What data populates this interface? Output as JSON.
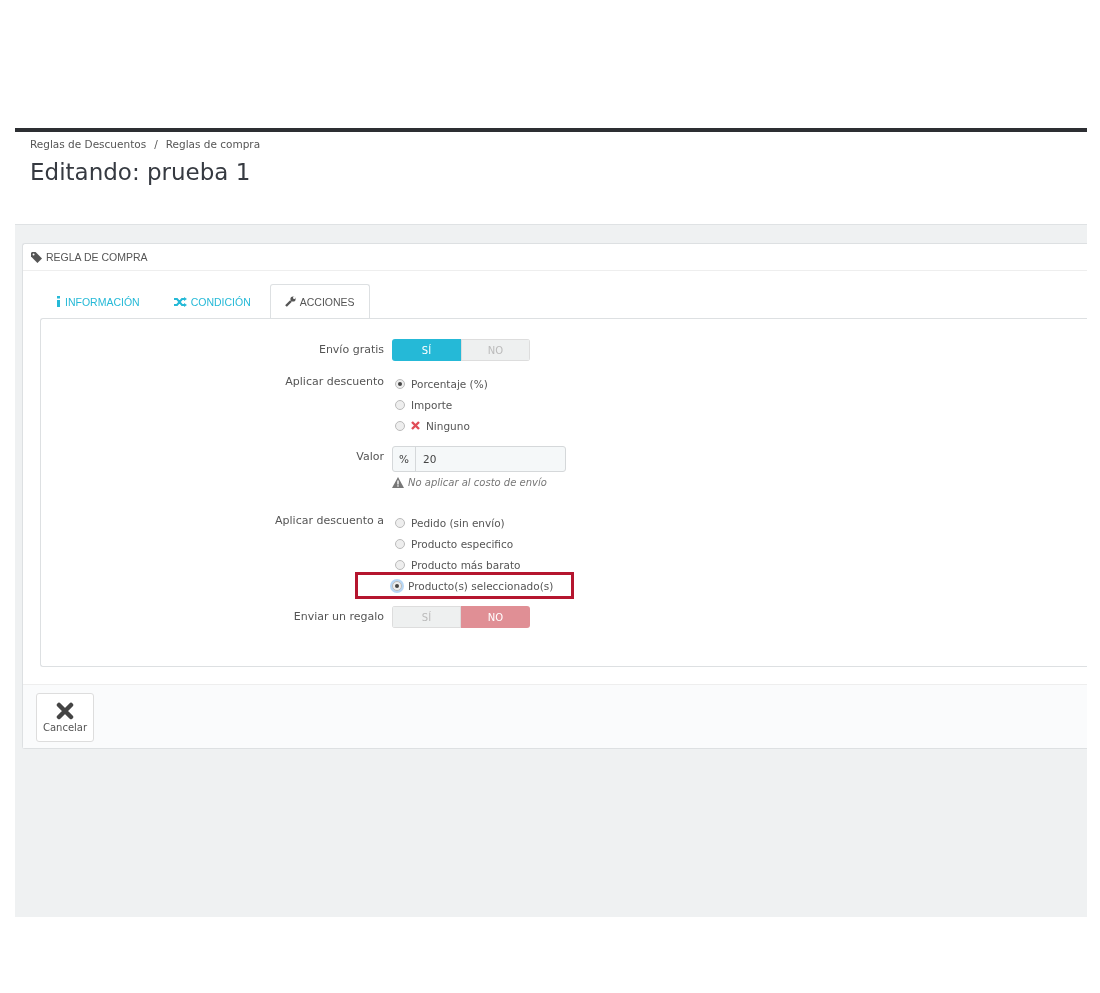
{
  "breadcrumb": [
    "Reglas de Descuentos",
    "Reglas de compra"
  ],
  "breadcrumb_separator": "/",
  "page_title": "Editando: prueba 1",
  "panel": {
    "title": "REGLA DE COMPRA"
  },
  "tabs": [
    {
      "label": "INFORMACIÓN",
      "selected": false
    },
    {
      "label": "CONDICIÓN",
      "selected": false
    },
    {
      "label": "ACCIONES",
      "selected": true
    }
  ],
  "fields": [
    {
      "kind": "toggle",
      "label": "Envío gratis",
      "color": "#25b9d7",
      "options": [
        {
          "label": "SÍ",
          "selected": true
        },
        {
          "label": "NO",
          "selected": false
        }
      ]
    },
    {
      "kind": "radio",
      "label": "Aplicar descuento",
      "options": [
        {
          "label": "Porcentaje (%)",
          "selected": true,
          "highlighted": false
        },
        {
          "label": "Importe",
          "selected": false,
          "highlighted": false
        },
        {
          "label": "Ninguno",
          "selected": false,
          "highlighted": false,
          "kind": "negated"
        }
      ]
    },
    {
      "kind": "input",
      "label": "Valor",
      "prefix": "%",
      "value": "20",
      "hint": "No aplicar al costo de envío"
    },
    {
      "kind": "radio",
      "label": "Aplicar descuento a",
      "options": [
        {
          "label": "Pedido (sin envío)",
          "selected": false,
          "highlighted": false
        },
        {
          "label": "Producto especifico",
          "selected": false,
          "highlighted": false
        },
        {
          "label": "Producto más barato",
          "selected": false,
          "highlighted": false
        },
        {
          "label": "Producto(s) seleccionado(s)",
          "selected": true,
          "highlighted": true
        }
      ]
    },
    {
      "kind": "toggle",
      "label": "Enviar un regalo",
      "color": "#e08f95",
      "options": [
        {
          "label": "SÍ",
          "selected": false
        },
        {
          "label": "NO",
          "selected": true
        }
      ]
    }
  ],
  "cancel_button": {
    "label": "Cancelar"
  }
}
